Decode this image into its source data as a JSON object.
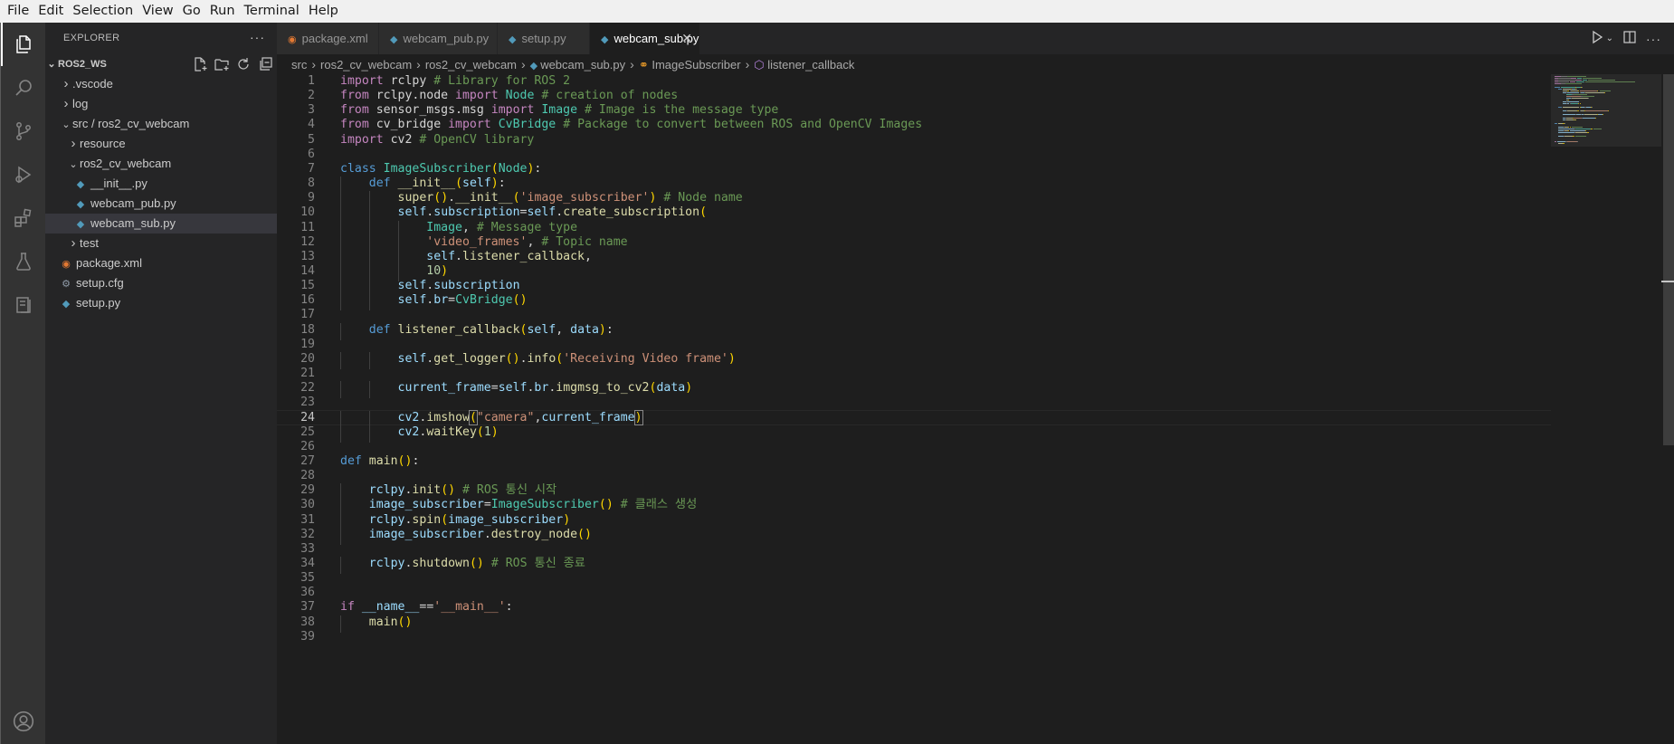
{
  "menu": [
    "File",
    "Edit",
    "Selection",
    "View",
    "Go",
    "Run",
    "Terminal",
    "Help"
  ],
  "explorer": {
    "title": "EXPLORER",
    "more": "···",
    "workspace": "ROS2_WS",
    "tree": [
      {
        "label": ".vscode",
        "type": "folder",
        "state": "collapsed"
      },
      {
        "label": "log",
        "type": "folder",
        "state": "collapsed"
      },
      {
        "label": "src / ros2_cv_webcam",
        "type": "folder",
        "state": "expanded"
      },
      {
        "label": "resource",
        "type": "folder",
        "state": "collapsed"
      },
      {
        "label": "ros2_cv_webcam",
        "type": "folder",
        "state": "expanded"
      },
      {
        "label": "__init__.py",
        "type": "python-file"
      },
      {
        "label": "webcam_pub.py",
        "type": "python-file"
      },
      {
        "label": "webcam_sub.py",
        "type": "python-file",
        "selected": true
      },
      {
        "label": "test",
        "type": "folder",
        "state": "collapsed"
      },
      {
        "label": "package.xml",
        "type": "xml-file"
      },
      {
        "label": "setup.cfg",
        "type": "config-file"
      },
      {
        "label": "setup.py",
        "type": "python-file"
      }
    ]
  },
  "tabs": [
    {
      "label": "package.xml",
      "icon": "xml-icon"
    },
    {
      "label": "webcam_pub.py",
      "icon": "python-icon"
    },
    {
      "label": "setup.py",
      "icon": "python-icon"
    },
    {
      "label": "webcam_sub.py",
      "icon": "python-icon",
      "active": true,
      "close": "✕"
    }
  ],
  "breadcrumb": [
    "src",
    "ros2_cv_webcam",
    "ros2_cv_webcam",
    "webcam_sub.py",
    "ImageSubscriber",
    "listener_callback"
  ],
  "editor": {
    "current_line": 24,
    "lines": [
      [
        [
          "keyword",
          "import"
        ],
        [
          "default",
          " rclpy "
        ],
        [
          "comment",
          "# Library for ROS 2"
        ]
      ],
      [
        [
          "keyword",
          "from"
        ],
        [
          "default",
          " rclpy.node "
        ],
        [
          "keyword",
          "import"
        ],
        [
          "default",
          " "
        ],
        [
          "class",
          "Node"
        ],
        [
          "default",
          " "
        ],
        [
          "comment",
          "# creation of nodes"
        ]
      ],
      [
        [
          "keyword",
          "from"
        ],
        [
          "default",
          " sensor_msgs.msg "
        ],
        [
          "keyword",
          "import"
        ],
        [
          "default",
          " "
        ],
        [
          "class",
          "Image"
        ],
        [
          "default",
          " "
        ],
        [
          "comment",
          "# Image is the message type"
        ]
      ],
      [
        [
          "keyword",
          "from"
        ],
        [
          "default",
          " cv_bridge "
        ],
        [
          "keyword",
          "import"
        ],
        [
          "default",
          " "
        ],
        [
          "class",
          "CvBridge"
        ],
        [
          "default",
          " "
        ],
        [
          "comment",
          "# Package to convert between ROS and OpenCV Images"
        ]
      ],
      [
        [
          "keyword",
          "import"
        ],
        [
          "default",
          " cv2 "
        ],
        [
          "comment",
          "# OpenCV library"
        ]
      ],
      [],
      [
        [
          "def",
          "class"
        ],
        [
          "default",
          " "
        ],
        [
          "class",
          "ImageSubscriber"
        ],
        [
          "bracket1",
          "("
        ],
        [
          "class",
          "Node"
        ],
        [
          "bracket1",
          ")"
        ],
        [
          "default",
          ":"
        ]
      ],
      [
        [
          "default",
          "    "
        ],
        [
          "def",
          "def"
        ],
        [
          "default",
          " "
        ],
        [
          "function",
          "__init__"
        ],
        [
          "bracket1",
          "("
        ],
        [
          "variable",
          "self"
        ],
        [
          "bracket1",
          ")"
        ],
        [
          "default",
          ":"
        ]
      ],
      [
        [
          "default",
          "        "
        ],
        [
          "function",
          "super"
        ],
        [
          "bracket1",
          "("
        ],
        [
          "bracket1",
          ")"
        ],
        [
          "default",
          "."
        ],
        [
          "function",
          "__init__"
        ],
        [
          "bracket1",
          "("
        ],
        [
          "string",
          "'image_subscriber'"
        ],
        [
          "bracket1",
          ")"
        ],
        [
          "default",
          " "
        ],
        [
          "comment",
          "# Node name"
        ]
      ],
      [
        [
          "default",
          "        "
        ],
        [
          "variable",
          "self"
        ],
        [
          "default",
          "."
        ],
        [
          "variable",
          "subscription"
        ],
        [
          "default",
          "="
        ],
        [
          "variable",
          "self"
        ],
        [
          "default",
          "."
        ],
        [
          "function",
          "create_subscription"
        ],
        [
          "bracket1",
          "("
        ]
      ],
      [
        [
          "default",
          "            "
        ],
        [
          "class",
          "Image"
        ],
        [
          "default",
          ", "
        ],
        [
          "comment",
          "# Message type"
        ]
      ],
      [
        [
          "default",
          "            "
        ],
        [
          "string",
          "'video_frames'"
        ],
        [
          "default",
          ", "
        ],
        [
          "comment",
          "# Topic name"
        ]
      ],
      [
        [
          "default",
          "            "
        ],
        [
          "variable",
          "self"
        ],
        [
          "default",
          "."
        ],
        [
          "function",
          "listener_callback"
        ],
        [
          "default",
          ","
        ]
      ],
      [
        [
          "default",
          "            "
        ],
        [
          "number",
          "10"
        ],
        [
          "bracket1",
          ")"
        ]
      ],
      [
        [
          "default",
          "        "
        ],
        [
          "variable",
          "self"
        ],
        [
          "default",
          "."
        ],
        [
          "variable",
          "subscription"
        ]
      ],
      [
        [
          "default",
          "        "
        ],
        [
          "variable",
          "self"
        ],
        [
          "default",
          "."
        ],
        [
          "variable",
          "br"
        ],
        [
          "default",
          "="
        ],
        [
          "class",
          "CvBridge"
        ],
        [
          "bracket1",
          "("
        ],
        [
          "bracket1",
          ")"
        ]
      ],
      [],
      [
        [
          "default",
          "    "
        ],
        [
          "def",
          "def"
        ],
        [
          "default",
          " "
        ],
        [
          "function",
          "listener_callback"
        ],
        [
          "bracket1",
          "("
        ],
        [
          "variable",
          "self"
        ],
        [
          "default",
          ", "
        ],
        [
          "variable",
          "data"
        ],
        [
          "bracket1",
          ")"
        ],
        [
          "default",
          ":"
        ]
      ],
      [],
      [
        [
          "default",
          "        "
        ],
        [
          "variable",
          "self"
        ],
        [
          "default",
          "."
        ],
        [
          "function",
          "get_logger"
        ],
        [
          "bracket1",
          "("
        ],
        [
          "bracket1",
          ")"
        ],
        [
          "default",
          "."
        ],
        [
          "function",
          "info"
        ],
        [
          "bracket1",
          "("
        ],
        [
          "string",
          "'Receiving Video frame'"
        ],
        [
          "bracket1",
          ")"
        ]
      ],
      [],
      [
        [
          "default",
          "        "
        ],
        [
          "variable",
          "current_frame"
        ],
        [
          "default",
          "="
        ],
        [
          "variable",
          "self"
        ],
        [
          "default",
          "."
        ],
        [
          "variable",
          "br"
        ],
        [
          "default",
          "."
        ],
        [
          "function",
          "imgmsg_to_cv2"
        ],
        [
          "bracket1",
          "("
        ],
        [
          "variable",
          "data"
        ],
        [
          "bracket1",
          ")"
        ]
      ],
      [],
      [
        [
          "default",
          "        "
        ],
        [
          "variable",
          "cv2"
        ],
        [
          "default",
          "."
        ],
        [
          "function",
          "imshow"
        ],
        [
          "bracket-match",
          "("
        ],
        [
          "string",
          "\"camera\""
        ],
        [
          "default",
          ","
        ],
        [
          "variable",
          "current_frame"
        ],
        [
          "bracket-match",
          ")"
        ]
      ],
      [
        [
          "default",
          "        "
        ],
        [
          "variable",
          "cv2"
        ],
        [
          "default",
          "."
        ],
        [
          "function",
          "waitKey"
        ],
        [
          "bracket1",
          "("
        ],
        [
          "number",
          "1"
        ],
        [
          "bracket1",
          ")"
        ]
      ],
      [],
      [
        [
          "def",
          "def"
        ],
        [
          "default",
          " "
        ],
        [
          "function",
          "main"
        ],
        [
          "bracket1",
          "("
        ],
        [
          "bracket1",
          ")"
        ],
        [
          "default",
          ":"
        ]
      ],
      [],
      [
        [
          "default",
          "    "
        ],
        [
          "variable",
          "rclpy"
        ],
        [
          "default",
          "."
        ],
        [
          "function",
          "init"
        ],
        [
          "bracket1",
          "("
        ],
        [
          "bracket1",
          ")"
        ],
        [
          "default",
          " "
        ],
        [
          "comment",
          "# ROS 통신 시작"
        ]
      ],
      [
        [
          "default",
          "    "
        ],
        [
          "variable",
          "image_subscriber"
        ],
        [
          "default",
          "="
        ],
        [
          "class",
          "ImageSubscriber"
        ],
        [
          "bracket1",
          "("
        ],
        [
          "bracket1",
          ")"
        ],
        [
          "default",
          " "
        ],
        [
          "comment",
          "# 클래스 생성"
        ]
      ],
      [
        [
          "default",
          "    "
        ],
        [
          "variable",
          "rclpy"
        ],
        [
          "default",
          "."
        ],
        [
          "function",
          "spin"
        ],
        [
          "bracket1",
          "("
        ],
        [
          "variable",
          "image_subscriber"
        ],
        [
          "bracket1",
          ")"
        ]
      ],
      [
        [
          "default",
          "    "
        ],
        [
          "variable",
          "image_subscriber"
        ],
        [
          "default",
          "."
        ],
        [
          "function",
          "destroy_node"
        ],
        [
          "bracket1",
          "("
        ],
        [
          "bracket1",
          ")"
        ]
      ],
      [],
      [
        [
          "default",
          "    "
        ],
        [
          "variable",
          "rclpy"
        ],
        [
          "default",
          "."
        ],
        [
          "function",
          "shutdown"
        ],
        [
          "bracket1",
          "("
        ],
        [
          "bracket1",
          ")"
        ],
        [
          "default",
          " "
        ],
        [
          "comment",
          "# ROS 통신 종료"
        ]
      ],
      [],
      [],
      [
        [
          "keyword",
          "if"
        ],
        [
          "default",
          " "
        ],
        [
          "variable",
          "__name__"
        ],
        [
          "default",
          "=="
        ],
        [
          "string",
          "'__main__'"
        ],
        [
          "default",
          ":"
        ]
      ],
      [
        [
          "default",
          "    "
        ],
        [
          "function",
          "main"
        ],
        [
          "bracket1",
          "("
        ],
        [
          "bracket1",
          ")"
        ]
      ],
      []
    ]
  }
}
